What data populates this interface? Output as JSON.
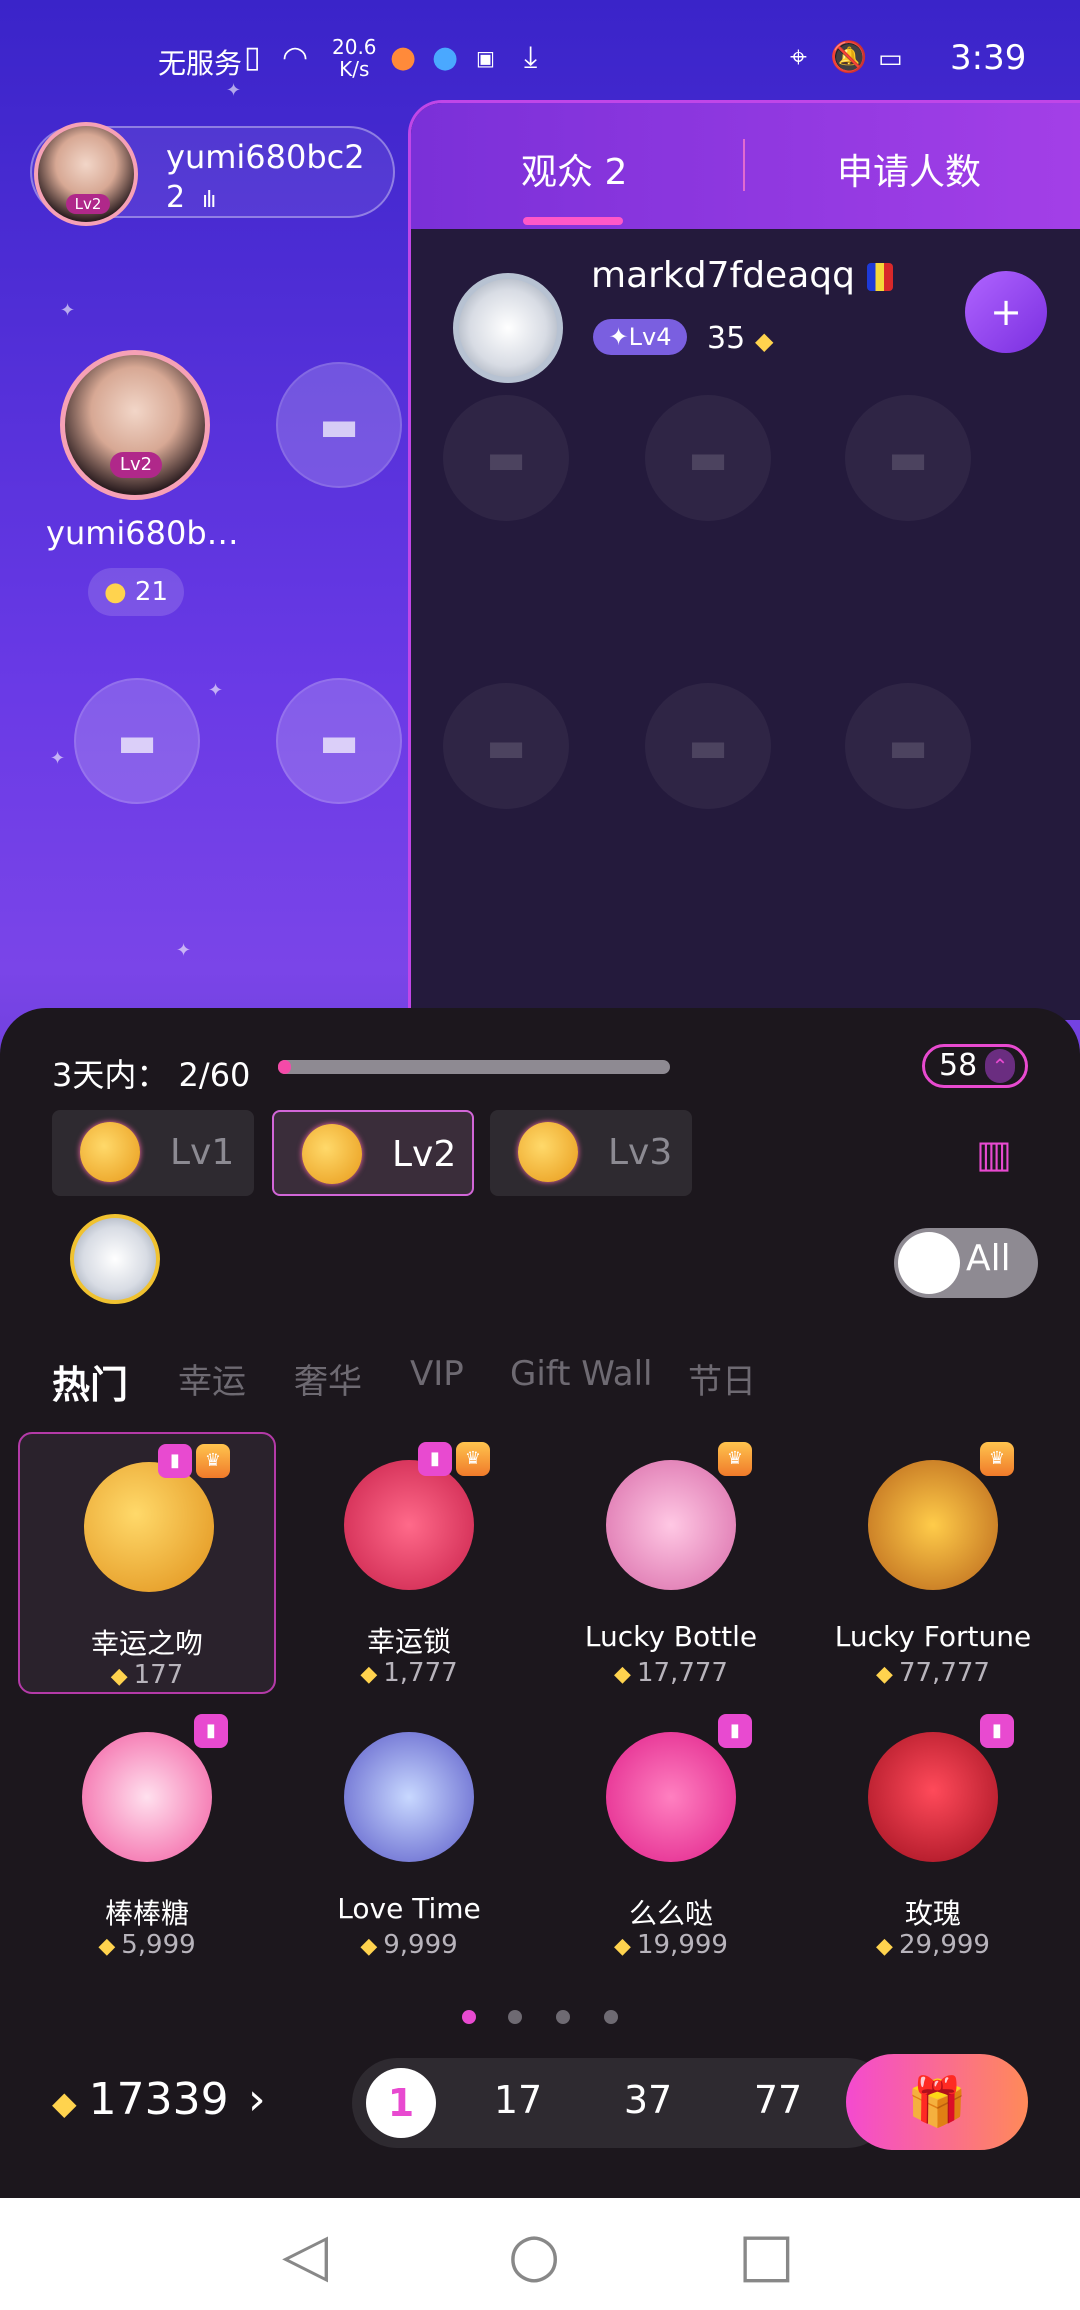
{
  "status_bar": {
    "carrier": "无服务",
    "net_speed_value": "20.6",
    "net_speed_unit": "K/s",
    "time": "3:39",
    "icons": [
      "sim-alert-icon",
      "wifi-icon",
      "browser-icon",
      "app-icon",
      "huawei-icon",
      "download-icon",
      "location-icon",
      "bell-muted-icon",
      "battery-icon"
    ]
  },
  "host": {
    "name": "yumi680bc2",
    "count": "2",
    "level": "Lv2"
  },
  "seat_user": {
    "name": "yumi680b…",
    "level": "Lv2",
    "coins": "21"
  },
  "audience_panel": {
    "tabs": [
      {
        "label": "观众 2",
        "active": true
      },
      {
        "label": "申请人数",
        "active": false
      }
    ],
    "members": [
      {
        "name": "markd7fdeaqq",
        "level": "Lv4",
        "score": "35"
      }
    ]
  },
  "gift_sheet": {
    "days_label": "3天内：",
    "days_progress_text": "2/60",
    "days_progress_value": 2,
    "days_progress_max": 60,
    "level_badge": "58",
    "level_tabs": [
      {
        "label": "Lv1",
        "active": false
      },
      {
        "label": "Lv2",
        "active": true
      },
      {
        "label": "Lv3",
        "active": false
      }
    ],
    "toggle_label": "All",
    "categories": [
      {
        "label": "热门",
        "active": true
      },
      {
        "label": "幸运",
        "active": false
      },
      {
        "label": "奢华",
        "active": false
      },
      {
        "label": "VIP",
        "active": false
      },
      {
        "label": "Gift Wall",
        "active": false
      },
      {
        "label": "节日",
        "active": false
      }
    ],
    "gifts": [
      {
        "name": "幸运之吻",
        "price": "177",
        "selected": true
      },
      {
        "name": "幸运锁",
        "price": "1,777",
        "selected": false
      },
      {
        "name": "Lucky Bottle",
        "price": "17,777",
        "selected": false
      },
      {
        "name": "Lucky Fortune",
        "price": "77,777",
        "selected": false
      },
      {
        "name": "棒棒糖",
        "price": "5,999",
        "selected": false
      },
      {
        "name": "Love Time",
        "price": "9,999",
        "selected": false
      },
      {
        "name": "么么哒",
        "price": "19,999",
        "selected": false
      },
      {
        "name": "玫瑰",
        "price": "29,999",
        "selected": false
      }
    ],
    "page_count": 4,
    "active_page": 1,
    "balance": "17339",
    "quantities": [
      "1",
      "17",
      "37",
      "77"
    ],
    "selected_quantity": "1"
  },
  "colors": {
    "accent": "#e84ad0",
    "gem": "#ffd34e",
    "sheet_bg": "#1c171d"
  }
}
